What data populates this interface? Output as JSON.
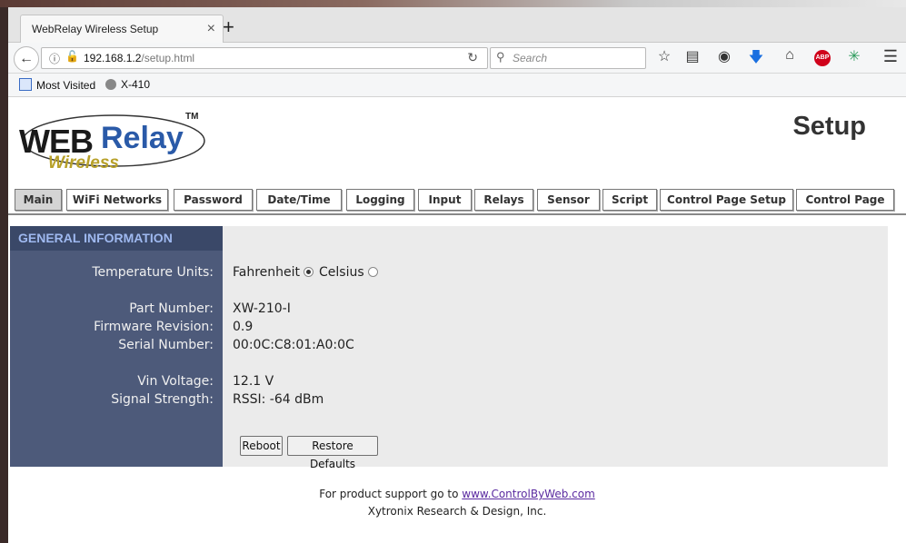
{
  "browser": {
    "tab_title": "WebRelay Wireless Setup",
    "tab_close": "×",
    "new_tab": "+",
    "url_host": "192.168.1.2",
    "url_path": "/setup.html",
    "search_placeholder": "Search",
    "bookmarks": [
      "Most Visited",
      "X-410"
    ],
    "abp_label": "ABP"
  },
  "logo": {
    "web": "WEB",
    "relay": "Relay",
    "wireless": "Wireless",
    "tm": "TM"
  },
  "page_title": "Setup",
  "menu": [
    {
      "label": "Main",
      "active": true
    },
    {
      "label": "WiFi Networks"
    },
    {
      "label": "Password"
    },
    {
      "label": "Date/Time"
    },
    {
      "label": "Logging"
    },
    {
      "label": "Input"
    },
    {
      "label": "Relays"
    },
    {
      "label": "Sensor"
    },
    {
      "label": "Script"
    },
    {
      "label": "Control Page Setup"
    },
    {
      "label": "Control Page"
    }
  ],
  "general": {
    "heading": "GENERAL INFORMATION",
    "temperature_label": "Temperature Units:",
    "fahrenheit": "Fahrenheit",
    "celsius": "Celsius",
    "selected_unit": "Fahrenheit",
    "part_number_label": "Part Number:",
    "part_number": "XW-210-I",
    "firmware_label": "Firmware Revision:",
    "firmware": "0.9",
    "serial_label": "Serial Number:",
    "serial": "00:0C:C8:01:A0:0C",
    "vin_label": "Vin Voltage:",
    "vin": "12.1 V",
    "signal_label": "Signal Strength:",
    "signal": "RSSI: -64 dBm",
    "reboot": "Reboot",
    "restore": "Restore Defaults"
  },
  "footer": {
    "support_prefix": "For product support go to",
    "support_link": "www.ControlByWeb.com",
    "company": "Xytronix Research & Design, Inc."
  }
}
